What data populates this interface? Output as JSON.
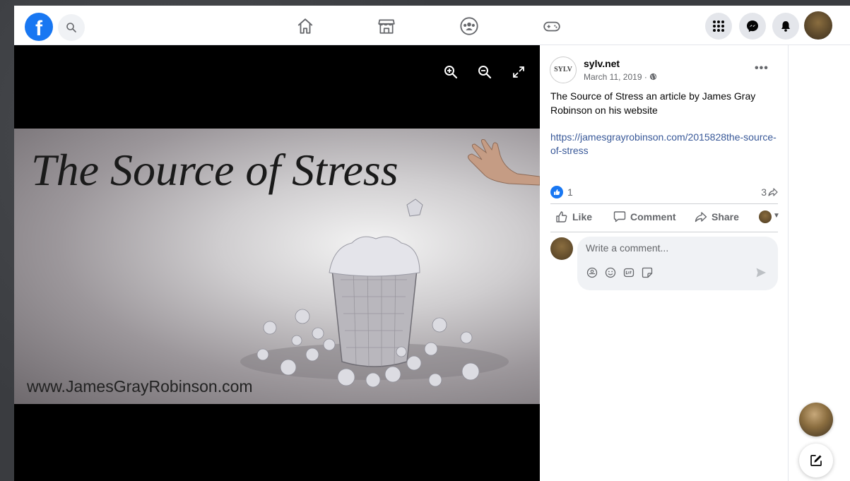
{
  "app": {
    "logo": "f"
  },
  "nav": {
    "icons": [
      "home-icon",
      "marketplace-icon",
      "groups-icon",
      "gaming-icon"
    ],
    "right_icons": [
      "menu-grid-icon",
      "messenger-icon",
      "notifications-icon"
    ]
  },
  "post": {
    "page_name": "sylv.net",
    "page_logo_text": "SYLV",
    "date": "March 11, 2019 ·",
    "more": "•••",
    "text": "The Source of Stress an article by James Gray Robinson on his website",
    "link": "https://jamesgrayrobinson.com/2015828the-source-of-stress",
    "reaction_count": "1",
    "share_count": "3"
  },
  "image": {
    "title": "The Source of Stress",
    "url_text": "www.JamesGrayRobinson.com"
  },
  "actions": {
    "like": "Like",
    "comment": "Comment",
    "share": "Share"
  },
  "comment": {
    "placeholder": "Write a comment..."
  },
  "colors": {
    "brand": "#1877f2",
    "link": "#385898",
    "muted": "#65676b"
  }
}
